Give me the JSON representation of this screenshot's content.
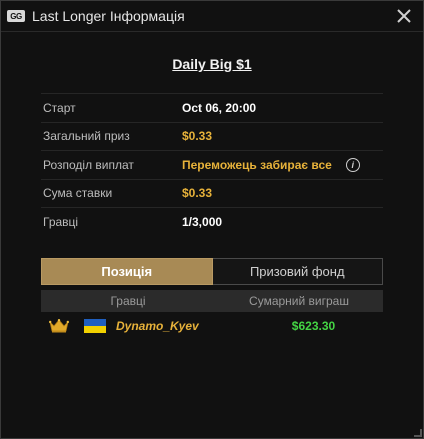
{
  "window": {
    "logo_text": "GG",
    "title": "Last Longer Інформація"
  },
  "event": {
    "title": "Daily Big $1"
  },
  "info": {
    "start_label": "Старт",
    "start_value": "Oct 06, 20:00",
    "prize_label": "Загальний приз",
    "prize_value": "$0.33",
    "payout_label": "Розподіл виплат",
    "payout_value": "Переможець забирає все",
    "stake_label": "Сума ставки",
    "stake_value": "$0.33",
    "players_label": "Гравці",
    "players_value": "1/3,000"
  },
  "tabs": [
    {
      "label": "Позиція",
      "active": true
    },
    {
      "label": "Призовий фонд",
      "active": false
    }
  ],
  "table": {
    "headers": [
      "Гравці",
      "Сумарний виграш"
    ],
    "rows": [
      {
        "player": "Dynamo_Kyev",
        "amount": "$623.30",
        "flag": "ukraine-flag-icon",
        "rank_icon": "crown-icon"
      }
    ]
  },
  "colors": {
    "accent_gold": "#e7b23a",
    "active_tab": "#a88a55",
    "win_green": "#44d544"
  }
}
